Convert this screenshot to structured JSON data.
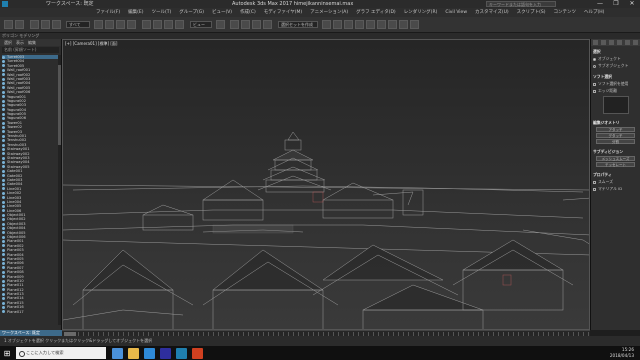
{
  "window": {
    "title": "Autodesk 3ds Max 2017   himejikanninsemai.max",
    "workspace": "ワークスペース: 既定",
    "search_placeholder": "キーワードまたは語句を入力",
    "controls": [
      "—",
      "❐",
      "✕"
    ]
  },
  "menu": [
    "ファイル(F)",
    "編集(E)",
    "ツール(T)",
    "グループ(G)",
    "ビュー(V)",
    "作成(C)",
    "モディファイヤ(M)",
    "アニメーション(A)",
    "グラフ エディタ(D)",
    "レンダリング(R)",
    "Civil View",
    "カスタマイズ(U)",
    "スクリプト(S)",
    "コンテンツ",
    "ヘルプ(H)"
  ],
  "toolbar": {
    "selection_set": "すべて",
    "view_dropdown": "ビュー",
    "named_selection": "選択セットを作成"
  },
  "ribbon_label": "ポリゴン モデリング",
  "scene_explorer": {
    "tabs": [
      "選択",
      "表示",
      "編集"
    ],
    "filter_label": "名前 (昇順ソート)",
    "items": [
      "Turret003",
      "Turret004",
      "Turret005",
      "Wall_roof001",
      "Wall_roof002",
      "Wall_roof003",
      "Wall_roof004",
      "Wall_roof005",
      "Wall_roof006",
      "Yagura001",
      "Yagura002",
      "Yagura003",
      "Yagura004",
      "Yagura005",
      "Yagura006",
      "Tower01",
      "Tower02",
      "Tower03",
      "Tenshu001",
      "Tenshu002",
      "Tenshu003",
      "Stairway001",
      "Stairway002",
      "Stairway003",
      "Stairway004",
      "Stairway005",
      "Gate001",
      "Gate002",
      "Gate003",
      "Gate004",
      "Line001",
      "Line002",
      "Line003",
      "Line004",
      "Line005",
      "Line006",
      "Object001",
      "Object002",
      "Object003",
      "Object004",
      "Object005",
      "Object006",
      "Plane001",
      "Plane002",
      "Plane003",
      "Plane004",
      "Plane005",
      "Plane006",
      "Plane007",
      "Plane008",
      "Plane009",
      "Plane010",
      "Plane011",
      "Plane012",
      "Plane013",
      "Plane014",
      "Plane015",
      "Plane016",
      "Plane017"
    ],
    "selected_index": 0,
    "footer": "ワークスペース: 既定"
  },
  "viewport": {
    "label": "[+] [Camera01] [標準] [面]"
  },
  "command_panel": {
    "sections": [
      {
        "header": "選択",
        "radios": [
          "オブジェクト",
          "サブオブジェクト"
        ]
      },
      {
        "header": "ソフト選択",
        "checks": [
          "ソフト選択を使用",
          "エッジ距離"
        ]
      },
      {
        "header": "編集ジオメトリ",
        "buttons": [
          "アタッチ",
          "デタッチ",
          "分割"
        ]
      },
      {
        "header": "サブディビジョン",
        "buttons": [
          "メッシュスムーズ",
          "テッセレート"
        ]
      },
      {
        "header": "プロパティ",
        "checks": [
          "スムーズ",
          "マテリアル ID"
        ]
      }
    ]
  },
  "timeline": {
    "position": "0 / 100"
  },
  "status": {
    "text": "1 オブジェクトを選択   クリックまたはクリック&ドラッグしてオブジェクトを選択"
  },
  "taskbar": {
    "search_placeholder": "ここに入力して検索",
    "time": "15:26",
    "date": "2018/04/13",
    "app_colors": [
      "#4a90d9",
      "#e8b84a",
      "#2e8ad8",
      "#2e2e9e",
      "#1f7fae",
      "#d04020"
    ]
  }
}
